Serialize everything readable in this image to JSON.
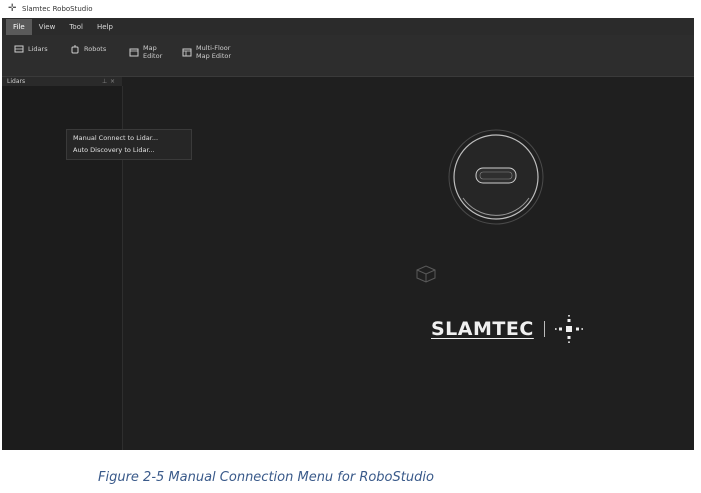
{
  "window": {
    "title": "Slamtec RoboStudio"
  },
  "menubar": {
    "items": [
      "File",
      "View",
      "Tool",
      "Help"
    ]
  },
  "toolbar": {
    "items": [
      {
        "label": "Lidars",
        "icon": "lidar-icon"
      },
      {
        "label": "Robots",
        "icon": "robot-icon"
      },
      {
        "label": "Map\nEditor",
        "icon": "map-icon"
      },
      {
        "label": "Multi-Floor\nMap Editor",
        "icon": "multi-floor-map-icon"
      }
    ]
  },
  "panel": {
    "title": "Lidars",
    "pin": "⊥",
    "close": "×"
  },
  "context_menu": {
    "items": [
      "Manual Connect to Lidar...",
      "Auto Discovery to Lidar..."
    ]
  },
  "logo": {
    "text": "SLAMTEC"
  },
  "caption": "Figure 2-5 Manual Connection Menu for RoboStudio",
  "colors": {
    "window_bg": "#1f1f1f",
    "menubar_bg": "#2b2b2b",
    "toolbar_bg": "#2d2d2d",
    "caption": "#3a5a8a"
  }
}
